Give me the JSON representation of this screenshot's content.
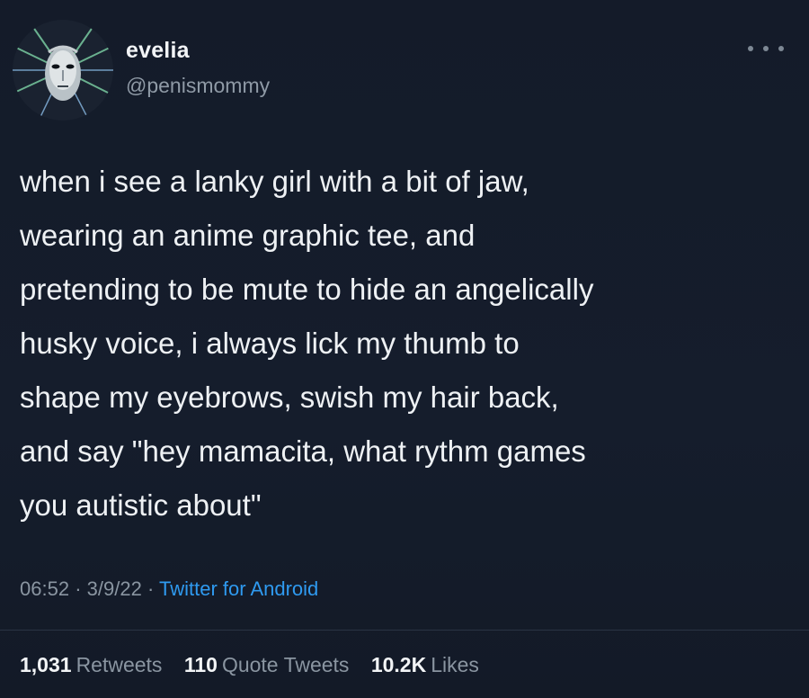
{
  "user": {
    "display_name": "evelia",
    "handle": "@penismommy",
    "avatar_icon": "robot-face-avatar"
  },
  "tweet": {
    "text": "when i see a lanky girl with a bit of jaw,\nwearing an anime graphic tee, and\npretending to be mute to hide an angelically\nhusky voice, i always lick my thumb to\nshape my eyebrows, swish my hair back,\nand say \"hey mamacita, what rythm games\nyou autistic about\"",
    "time": "06:52",
    "date": "3/9/22",
    "source": "Twitter for Android"
  },
  "stats": {
    "retweets_count": "1,031",
    "retweets_label": "Retweets",
    "quote_count": "110",
    "quote_label": "Quote Tweets",
    "likes_count": "10.2K",
    "likes_label": "Likes"
  },
  "colors": {
    "background": "#141c2b",
    "link": "#2f9af0",
    "muted": "#8a95a1"
  }
}
